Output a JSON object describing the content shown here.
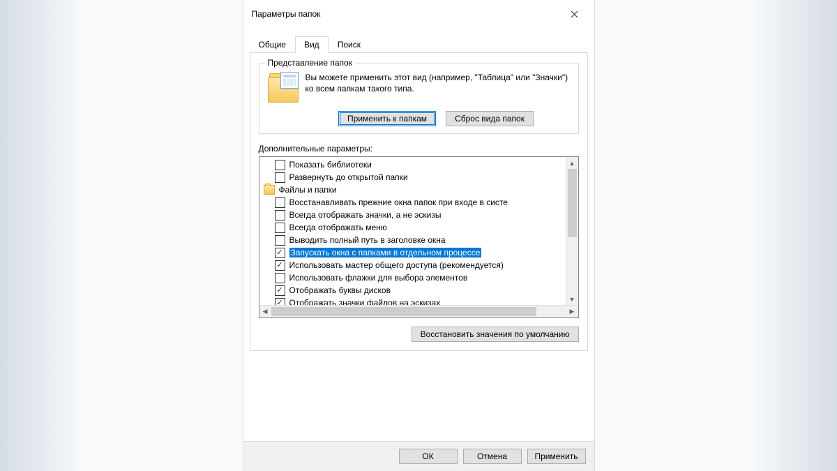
{
  "title": "Параметры папок",
  "tabs": {
    "general": "Общие",
    "view": "Вид",
    "search": "Поиск"
  },
  "group": {
    "title": "Представление папок",
    "text": "Вы можете применить этот вид (например, \"Таблица\" или \"Значки\") ко всем папкам такого типа.",
    "apply": "Применить к папкам",
    "reset": "Сброс вида папок"
  },
  "advanced": {
    "label": "Дополнительные параметры:",
    "items": [
      {
        "type": "check",
        "checked": false,
        "label": "Показать библиотеки"
      },
      {
        "type": "check",
        "checked": false,
        "label": "Развернуть до открытой папки"
      },
      {
        "type": "header",
        "label": "Файлы и папки"
      },
      {
        "type": "check",
        "checked": false,
        "label": "Восстанавливать прежние окна папок при входе в систе"
      },
      {
        "type": "check",
        "checked": false,
        "label": "Всегда отображать значки, а не эскизы"
      },
      {
        "type": "check",
        "checked": false,
        "label": "Всегда отображать меню"
      },
      {
        "type": "check",
        "checked": false,
        "label": "Выводить полный путь в заголовке окна"
      },
      {
        "type": "check",
        "checked": true,
        "selected": true,
        "label": "Запускать окна с папками в отдельном процессе"
      },
      {
        "type": "check",
        "checked": true,
        "label": "Использовать мастер общего доступа (рекомендуется)"
      },
      {
        "type": "check",
        "checked": false,
        "label": "Использовать флажки для выбора элементов"
      },
      {
        "type": "check",
        "checked": true,
        "label": "Отображать буквы дисков"
      },
      {
        "type": "check",
        "checked": true,
        "label": "Отображать значки файлов на эскизах"
      }
    ]
  },
  "restore_defaults": "Восстановить значения по умолчанию",
  "footer": {
    "ok": "ОК",
    "cancel": "Отмена",
    "apply": "Применить"
  }
}
